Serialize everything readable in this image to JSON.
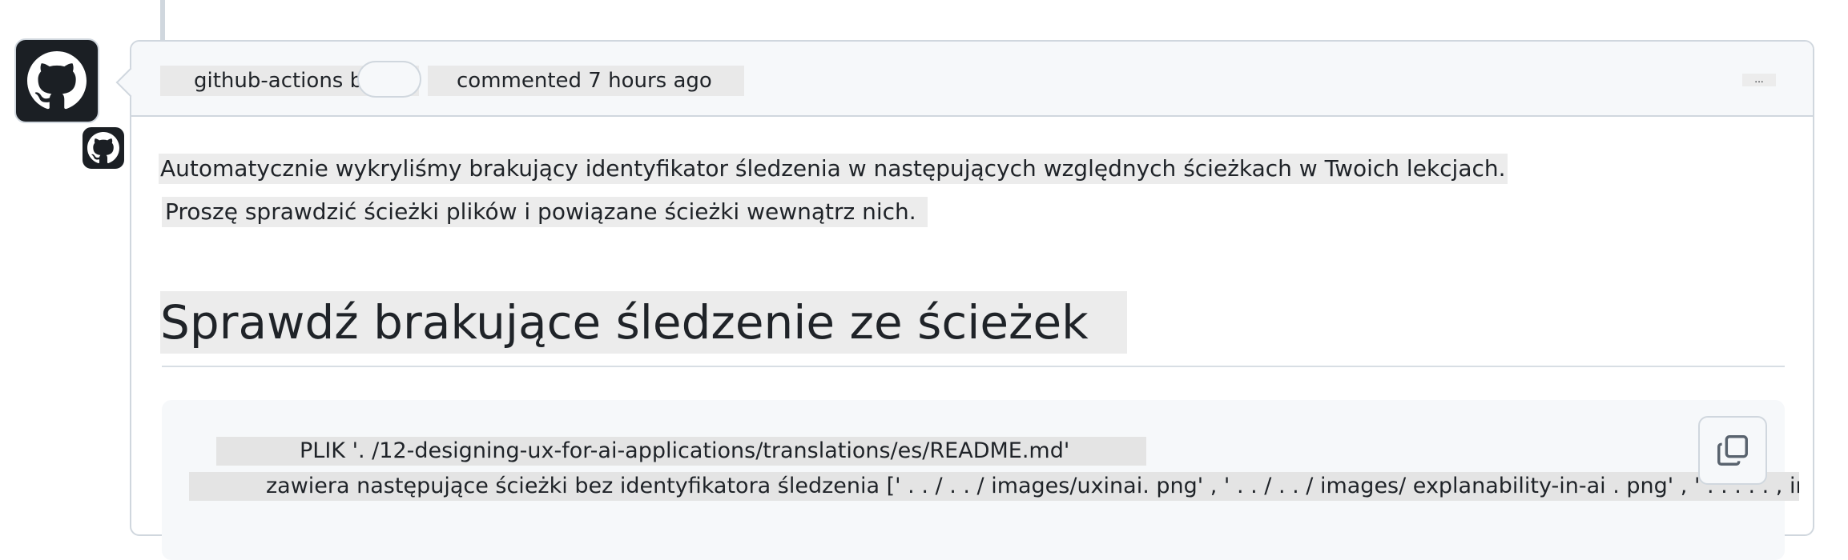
{
  "comment": {
    "author": "github-actions bot",
    "bot_label": "",
    "timestamp": "commented 7 hours ago",
    "more_menu": "...",
    "avatar_icon": "github-mark-icon",
    "avatar_badge_icon": "github-mark-icon"
  },
  "body": {
    "paragraph1": "Automatycznie wykryliśmy brakujący identyfikator śledzenia w następujących względnych ścieżkach w Twoich lekcjach.",
    "paragraph2": "Proszę sprawdzić ścieżki plików i powiązane ścieżki wewnątrz nich.",
    "heading": "Sprawdź brakujące śledzenie ze ścieżek"
  },
  "code": {
    "line1": "PLIK '. /12-designing-ux-for-ai-applications/translations/es/README.md'",
    "line2": "zawiera następujące ścieżki bez identyfikatora śledzenia [' . . / . . / images/uxinai. png' , ' . . / . . / images/ explanability-in-ai . png' , ' . . . . . , im",
    "copy_icon": "copy-icon"
  }
}
